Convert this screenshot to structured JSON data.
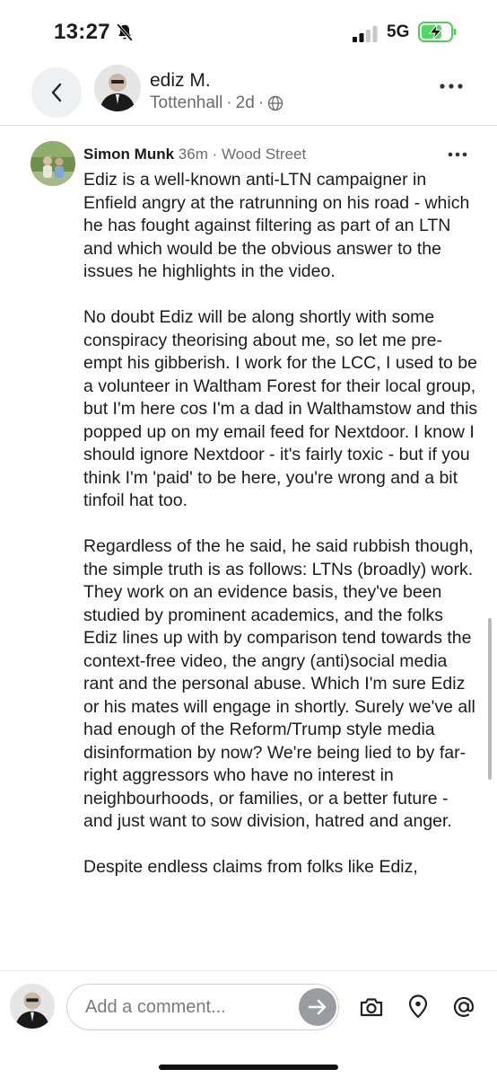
{
  "status_bar": {
    "time": "13:27",
    "network": "5G",
    "icons": [
      "bell-off-icon",
      "signal-icon",
      "battery-charging-icon"
    ]
  },
  "post": {
    "author_name": "ediz M.",
    "author_location": "Tottenhall",
    "author_age": "2d",
    "separator": "·",
    "visibility_icon": "globe-icon"
  },
  "comment": {
    "author_name": "Simon Munk",
    "time": "36m",
    "location": "Wood Street",
    "paragraphs": [
      "Ediz is a well-known anti-LTN campaigner in Enfield angry at the ratrunning on his road - which he has fought against filtering as part of an LTN and which would be the obvious answer to the issues he highlights in the video.",
      "No doubt Ediz will be along shortly with some conspiracy theorising about me, so let me pre-empt his gibberish. I work for the LCC, I used to be a volunteer in Waltham Forest for their local group, but I'm here cos I'm a dad in Walthamstow and this popped up on my email feed for Nextdoor. I know I should ignore Nextdoor - it's fairly toxic - but if you think I'm 'paid' to be here, you're wrong and a bit tinfoil hat too.",
      "Regardless of the he said, he said rubbish though, the simple truth is as follows: LTNs (broadly) work. They work on an evidence basis, they've been studied by prominent academics, and the folks Ediz lines up with by comparison tend towards the context-free video, the angry (anti)social media rant and the personal abuse. Which I'm sure Ediz or his mates will engage in shortly. Surely we've all had enough of the Reform/Trump style media disinformation by now? We're being lied to by far-right aggressors who have no interest in neighbourhoods, or families, or a better future - and just want to sow division, hatred and anger.",
      "Despite endless claims from folks like Ediz,"
    ]
  },
  "composer": {
    "placeholder": "Add a comment...",
    "icons": [
      "send-arrow-icon",
      "camera-icon",
      "location-pin-icon",
      "at-mention-icon"
    ]
  },
  "colors": {
    "text": "#1c1c1e",
    "secondary_text": "#6b6b70",
    "send_button": "#9a9ca2",
    "back_button_bg": "#eff0f2"
  }
}
